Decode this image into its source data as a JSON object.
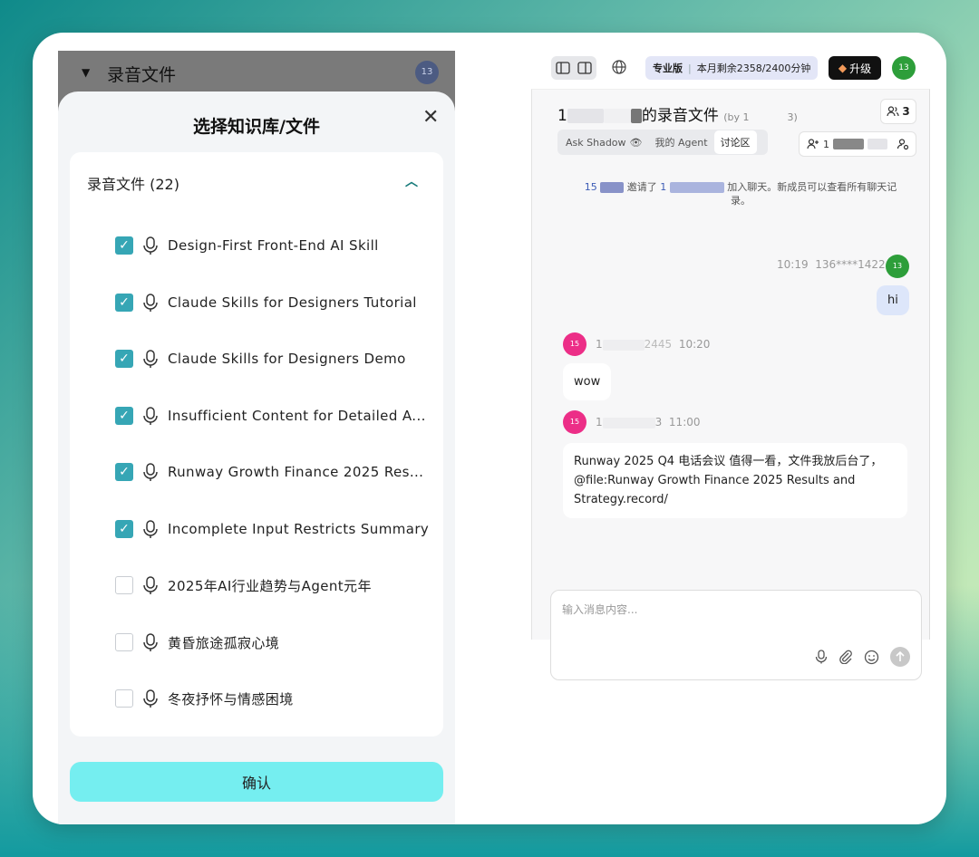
{
  "left": {
    "header_title": "录音文件",
    "header_avatar": "13",
    "sheet_title": "选择知识库/文件",
    "group_title": "录音文件 (22)",
    "items": [
      {
        "label": "Design-First Front-End AI Skill",
        "checked": true
      },
      {
        "label": "Claude Skills for Designers Tutorial",
        "checked": true
      },
      {
        "label": "Claude Skills for Designers Demo",
        "checked": true
      },
      {
        "label": "Insufficient Content for Detailed A...",
        "checked": true
      },
      {
        "label": "Runway Growth Finance 2025 Res...",
        "checked": true
      },
      {
        "label": "Incomplete Input Restricts Summary",
        "checked": true
      },
      {
        "label": "2025年AI行业趋势与Agent元年",
        "checked": false
      },
      {
        "label": "黄昏旅途孤寂心境",
        "checked": false
      },
      {
        "label": "冬夜抒怀与情感困境",
        "checked": false
      }
    ],
    "confirm_label": "确认"
  },
  "right": {
    "plan_label": "专业版",
    "quota_text": "本月剩余2358/2400分钟",
    "upgrade_label": "升级",
    "user_avatar": "13",
    "room_prefix": "1",
    "room_title": "的录音文件",
    "room_by": "(by 1",
    "room_by_end": "3)",
    "member_count": "3",
    "tabs": [
      "Ask Shadow",
      "我的 Agent",
      "讨论区"
    ],
    "invite_prefix": "1",
    "system_message": {
      "from": "15",
      "verb": "邀请了",
      "to": "1",
      "text": "加入聊天。新成员可以查看所有聊天记录。"
    },
    "messages": [
      {
        "time": "10:19",
        "user": "136****1422",
        "avatar": "13",
        "text": "hi"
      },
      {
        "time": "10:20",
        "user": "1",
        "user_end": "2445",
        "avatar": "15",
        "text": "wow"
      },
      {
        "time": "11:00",
        "user": "1",
        "user_end": "3",
        "avatar": "15",
        "text": "Runway 2025 Q4 电话会议 值得一看，文件我放后台了，@file:Runway Growth Finance 2025 Results and Strategy.record/"
      }
    ],
    "input_placeholder": "输入消息内容..."
  },
  "colors": {
    "checkbox_on": "#36a6b5",
    "confirm_button": "#75eef0",
    "my_bubble": "#dde6fa",
    "avatar_green": "#2d9e3a",
    "avatar_pink": "#ec2e87"
  }
}
